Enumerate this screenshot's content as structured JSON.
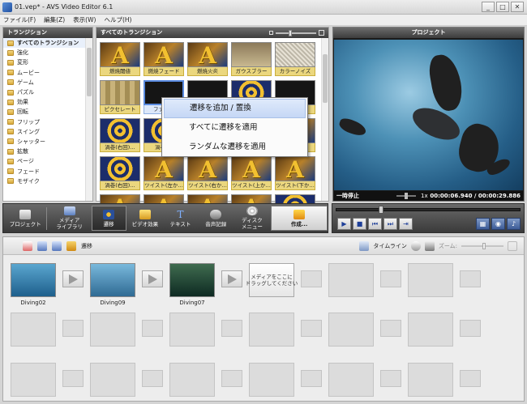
{
  "window": {
    "title": "01.vep* - AVS Video Editor 6.1",
    "controls": [
      "_",
      "□",
      "✕"
    ]
  },
  "menu": [
    "ファイル(F)",
    "編集(Z)",
    "表示(W)",
    "ヘルプ(H)"
  ],
  "categories": {
    "header": "トランジション",
    "items": [
      "すべてのトランジション",
      "強化",
      "変形",
      "ムービー",
      "ゲーム",
      "パズル",
      "効果",
      "回転",
      "フリップ",
      "スイング",
      "シャッター",
      "拡散",
      "ページ",
      "フェード",
      "モザイク"
    ]
  },
  "transitions": {
    "header": "すべてのトランジション",
    "items": [
      {
        "label": "燃焼閾値",
        "style": "img-a"
      },
      {
        "label": "燃焼フェード",
        "style": "img-a"
      },
      {
        "label": "燃焼火炎",
        "style": "img-a"
      },
      {
        "label": "ガウスブラー",
        "style": "img-blur"
      },
      {
        "label": "カラーノイズ",
        "style": "img-noise"
      },
      {
        "label": "ピクセレート",
        "style": "img-pixel"
      },
      {
        "label": "ファッシ",
        "style": "img-dark"
      },
      {
        "label": "",
        "style": "img-dark"
      },
      {
        "label": "",
        "style": "img-swirl"
      },
      {
        "label": "",
        "style": "img-dark"
      },
      {
        "label": "渦巻(右回)…",
        "style": "img-swirl"
      },
      {
        "label": "渦巻(右",
        "style": "img-swirl"
      },
      {
        "label": "",
        "style": "img-a"
      },
      {
        "label": "",
        "style": "img-a"
      },
      {
        "label": "",
        "style": "img-a"
      },
      {
        "label": "渦巻(右回)…",
        "style": "img-swirl"
      },
      {
        "label": "ツイスト(左か…",
        "style": "img-a"
      },
      {
        "label": "ツイスト(右か…",
        "style": "img-a"
      },
      {
        "label": "ツイスト(上か…",
        "style": "img-a"
      },
      {
        "label": "ツイスト(下か…",
        "style": "img-a"
      },
      {
        "label": "",
        "style": "img-a"
      },
      {
        "label": "",
        "style": "img-a"
      },
      {
        "label": "",
        "style": "img-a"
      },
      {
        "label": "",
        "style": "img-a"
      },
      {
        "label": "",
        "style": "img-swirl"
      }
    ]
  },
  "context_menu": {
    "items": [
      "遷移を追加 / 置換",
      "すべてに遷移を適用",
      "ランダムな遷移を適用"
    ]
  },
  "preview": {
    "header": "プロジェクト",
    "status": "一時停止",
    "speed": "1x",
    "current_time": "00:00:06.940",
    "total_time": "00:00:29.886",
    "time_sep": "/"
  },
  "toolbar": {
    "project": "プロジェクト",
    "media_library": "メディア\nライブラリ",
    "transitions": "遷移",
    "video_effects": "ビデオ効果",
    "text": "テキスト",
    "voice_record": "音声記録",
    "disc_menu": "ディスク\nメニュー",
    "create": "作成..."
  },
  "playback": {
    "buttons": [
      "▶",
      "■",
      "⏮",
      "⏭",
      "⇥"
    ],
    "right_buttons": [
      "▦",
      "◉",
      "♪"
    ]
  },
  "storyboard": {
    "mode_label": "遷移",
    "timeline_label": "タイムライン",
    "zoom_label": "ズーム:",
    "clips": [
      "Diving02",
      "Diving09",
      "Diving07"
    ],
    "drop_text": "メディアをここに\nドラッグしてください"
  }
}
